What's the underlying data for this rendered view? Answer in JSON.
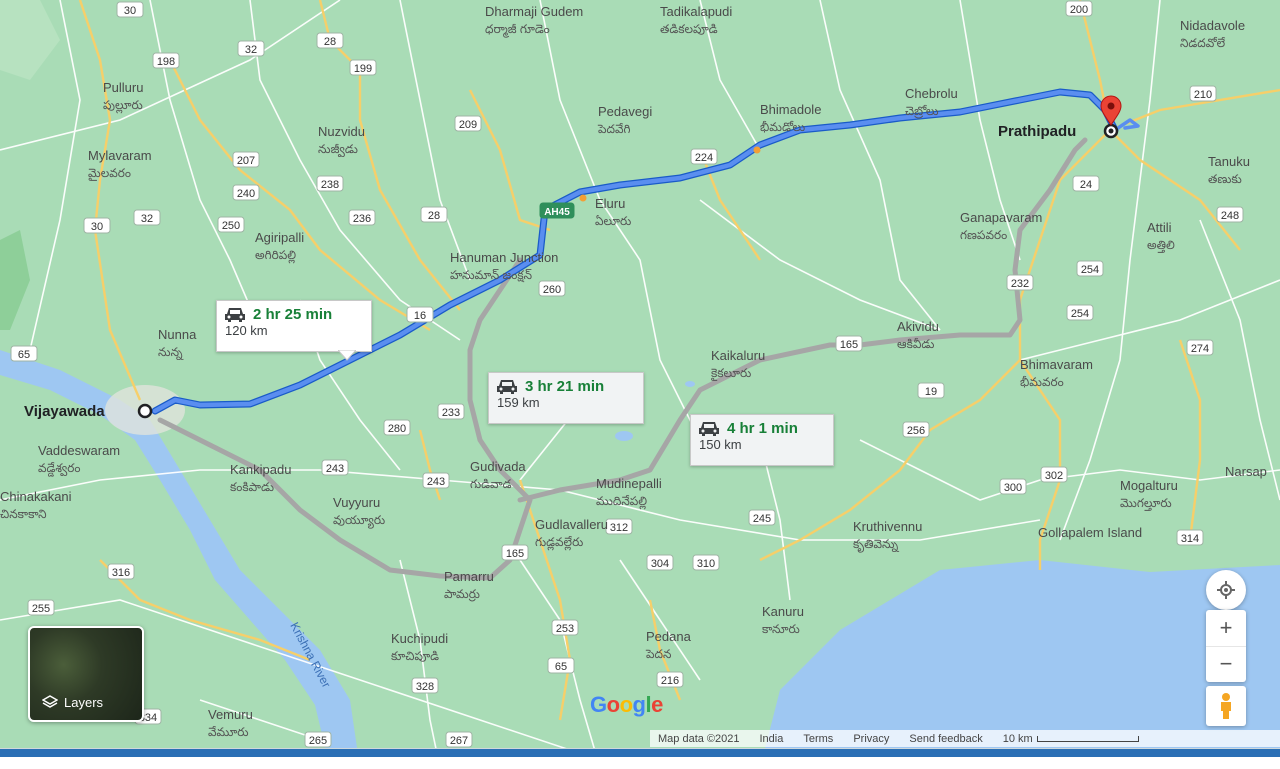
{
  "map": {
    "places": [
      {
        "en": "Dharmaji Gudem",
        "te": "ధర్మాజీ గూడెం"
      },
      {
        "en": "Tadikalapudi",
        "te": "తడికలపూడి"
      },
      {
        "en": "Nidadavole",
        "te": "నిడదవోలే"
      },
      {
        "en": "Pulluru",
        "te": "పుల్లూరు"
      },
      {
        "en": "Nuzvidu",
        "te": "నుజ్వీడు"
      },
      {
        "en": "Pedavegi",
        "te": "పెదవేగి"
      },
      {
        "en": "Bhimadole",
        "te": "భీమడోలు"
      },
      {
        "en": "Chebrolu",
        "te": "చెబ్రోలు"
      },
      {
        "en": "Mylavaram",
        "te": "మైలవరం"
      },
      {
        "en": "Eluru",
        "te": "ఏలూరు"
      },
      {
        "en": "Tanuku",
        "te": "తణుకు"
      },
      {
        "en": "Agiripalli",
        "te": "అగిరిపల్లి"
      },
      {
        "en": "Hanuman Junction",
        "te": "హనుమాన్ జంక్షన్"
      },
      {
        "en": "Ganapavaram",
        "te": "గణపవరం"
      },
      {
        "en": "Attili",
        "te": "అత్తిలి"
      },
      {
        "en": "Nunna",
        "te": "నున్న"
      },
      {
        "en": "Akividu",
        "te": "ఆకివీడు"
      },
      {
        "en": "Kaikaluru",
        "te": "కైకలూరు"
      },
      {
        "en": "Bhimavaram",
        "te": "భీమవరం"
      },
      {
        "en": "Vaddeswaram",
        "te": "వడ్డేశ్వరం"
      },
      {
        "en": "Kankipadu",
        "te": "కంకిపాడు"
      },
      {
        "en": "Gudivada",
        "te": "గుడివాడ"
      },
      {
        "en": "Mudinepalli",
        "te": "ముదినేపల్లి"
      },
      {
        "en": "Chinakakani",
        "te": "చినకాకాని"
      },
      {
        "en": "Kruthivennu",
        "te": "కృతివెన్ను"
      },
      {
        "en": "Mogalturu",
        "te": "మొగల్తూరు"
      },
      {
        "en": "Narsap"
      },
      {
        "en": "Vuyyuru",
        "te": "వుయ్యూరు"
      },
      {
        "en": "Gudlavalleru",
        "te": "గుడ్లవల్లేరు"
      },
      {
        "en": "Gollapalem Island"
      },
      {
        "en": "Pamarru",
        "te": "పామర్రు"
      },
      {
        "en": "Kanuru",
        "te": "కానూరు"
      },
      {
        "en": "Kuchipudi",
        "te": "కూచిపూడి"
      },
      {
        "en": "Pedana",
        "te": "పెదన"
      },
      {
        "en": "Vemuru",
        "te": "వేమూరు"
      },
      {
        "en": "Krishna River"
      }
    ],
    "origin": "Vijayawada",
    "destination": "Prathipadu",
    "shields": [
      "30",
      "198",
      "32",
      "28",
      "199",
      "209",
      "224",
      "200",
      "210",
      "207",
      "240",
      "238",
      "236",
      "28",
      "250",
      "30",
      "32",
      "260",
      "24",
      "248",
      "254",
      "232",
      "16",
      "254",
      "274",
      "165",
      "65",
      "233",
      "280",
      "19",
      "256",
      "243",
      "243",
      "245",
      "302",
      "300",
      "314",
      "316",
      "312",
      "304",
      "310",
      "255",
      "253",
      "165",
      "216",
      "65",
      "328",
      "334",
      "265",
      "267",
      "AH45"
    ],
    "routes": [
      {
        "duration": "2 hr 25 min",
        "distance": "120 km",
        "selected": true
      },
      {
        "duration": "3 hr 21 min",
        "distance": "159 km",
        "selected": false
      },
      {
        "duration": "4 hr 1 min",
        "distance": "150 km",
        "selected": false
      }
    ],
    "colors": {
      "land": "#a8dab5",
      "water": "#9ec8f0",
      "route_selected": "#4a7fe0",
      "route_alt": "#b5b5b5",
      "road_major": "#f9cf6b",
      "road_minor": "#ffffff",
      "pin": "#ea4335"
    }
  },
  "controls": {
    "layers_label": "Layers",
    "zoom_in": "+",
    "zoom_out": "−",
    "icons": [
      "my-location-icon",
      "zoom-in-icon",
      "zoom-out-icon",
      "pegman-icon",
      "layers-icon"
    ]
  },
  "footer": {
    "map_data": "Map data ©2021",
    "country": "India",
    "terms": "Terms",
    "privacy": "Privacy",
    "feedback": "Send feedback",
    "scale": "10 km"
  },
  "logo": "Google"
}
